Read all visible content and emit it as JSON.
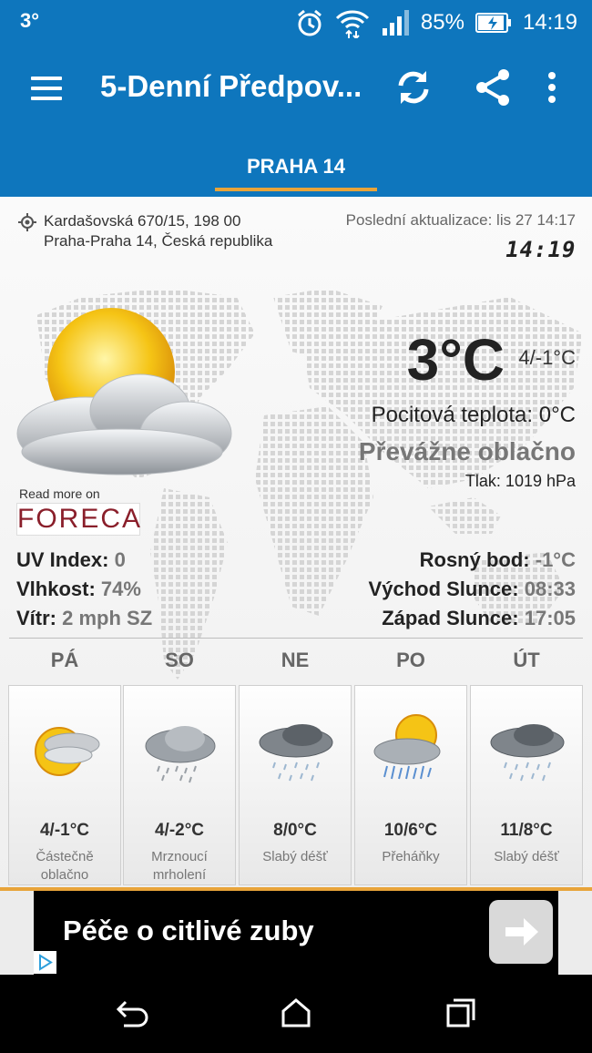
{
  "status_bar": {
    "temperature": "3°",
    "battery": "85%",
    "time": "14:19"
  },
  "app_bar": {
    "title": "5-Denní Předpov..."
  },
  "tabs": [
    {
      "label": "PRAHA 14",
      "selected": true
    }
  ],
  "location": {
    "address_line1": "Kardašovská 670/15, 198 00",
    "address_line2": "Praha-Praha 14, Česká republika",
    "last_update": "Poslední aktualizace: lis 27  14:17",
    "clock": "14:19"
  },
  "current": {
    "temperature": "3°C",
    "range": "4/-1°C",
    "feels_like": "Pocitová teplota: 0°C",
    "condition": "Převážne oblačno",
    "pressure": "Tlak: 1019 hPa",
    "read_more": "Read more on",
    "provider": "FORECA"
  },
  "stats_left": [
    {
      "label": "UV Index:",
      "value": "0"
    },
    {
      "label": "Vlhkost:",
      "value": "74%"
    },
    {
      "label": "Vítr:",
      "value": "2 mph SZ"
    }
  ],
  "stats_right": [
    {
      "label": "Rosný bod:",
      "value": "-1°C"
    },
    {
      "label": "Východ Slunce:",
      "value": "08:33"
    },
    {
      "label": "Západ Slunce:",
      "value": "17:05"
    }
  ],
  "forecast": [
    {
      "day": "PÁ",
      "temp": "4/-1°C",
      "desc_line1": "Částečně",
      "desc_line2": "oblačno",
      "icon": "partly-cloudy-icon"
    },
    {
      "day": "SO",
      "temp": "4/-2°C",
      "desc_line1": "Mrznoucí",
      "desc_line2": "mrholení",
      "icon": "freezing-drizzle-icon"
    },
    {
      "day": "NE",
      "temp": "8/0°C",
      "desc_line1": "Slabý déšť",
      "desc_line2": "",
      "icon": "light-rain-icon"
    },
    {
      "day": "PO",
      "temp": "10/6°C",
      "desc_line1": "Přeháňky",
      "desc_line2": "",
      "icon": "showers-icon"
    },
    {
      "day": "ÚT",
      "temp": "11/8°C",
      "desc_line1": "Slabý déšť",
      "desc_line2": "",
      "icon": "light-rain-icon"
    }
  ],
  "ad": {
    "text": "Péče o citlivé zuby"
  },
  "colors": {
    "primary": "#0e76bd",
    "accent": "#e8a43a"
  }
}
